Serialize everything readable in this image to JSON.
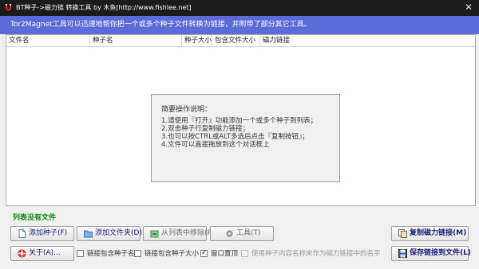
{
  "window": {
    "title": "BT种子->磁力链 转换工具 by 木鱼[http://www.fishlee.net]",
    "close_glyph": "✕"
  },
  "banner": {
    "text": "Tor2Magnet工具可以迅速地帮你把一个或多个种子文件转换为链接，并附带了部分其它工具。"
  },
  "list": {
    "columns": [
      "文件名",
      "种子名",
      "种子大小",
      "包含文件大小",
      "磁力链接"
    ]
  },
  "help": {
    "title": "简要操作说明：",
    "lines": [
      "1.请使用『打开』功能添加一个或多个种子到列表；",
      "2.双击种子行复制磁力链接；",
      "3.也可以按CTRL或ALT多选后点击『复制按钮』；",
      "4.文件可以直接拖放到这个对话框上"
    ]
  },
  "status": {
    "text": "列表没有文件",
    "color": "#0a8a0a"
  },
  "buttons": {
    "add_torrent": "添加种子(F)",
    "add_folder": "添加文件夹(D)",
    "remove": "从列表中移除(R)",
    "tools": "工具(T)",
    "copy_magnet": "复制磁力链接(M)",
    "about": "关于(A)...",
    "save_links": "保存链接到文件(L)"
  },
  "options": {
    "include_torrent_name": {
      "label": "链接包含种子名",
      "checked": false
    },
    "include_torrent_size": {
      "label": "链接包含种子大小",
      "checked": false
    },
    "window_on_top": {
      "label": "窗口置顶",
      "checked": true
    },
    "use_content_name": {
      "label": "使用种子内容名称来作为磁力链接中的名字",
      "checked": false,
      "enabled": false
    }
  },
  "colors": {
    "banner": "#5b6bd9",
    "titlebar": "#1b1b1b",
    "button_text": "#1a1a7a"
  }
}
